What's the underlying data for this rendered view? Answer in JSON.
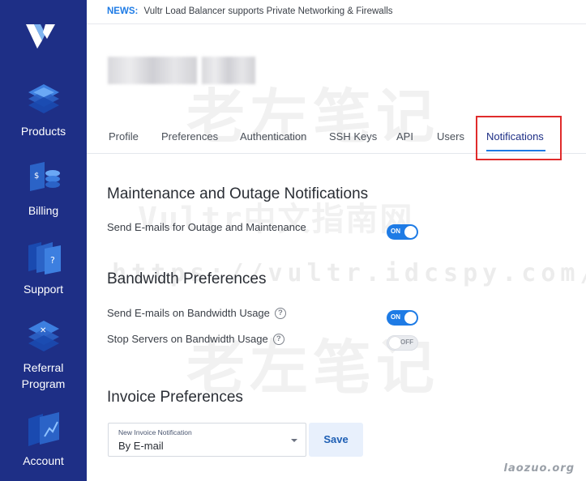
{
  "news": {
    "label": "NEWS:",
    "text": "Vultr Load Balancer supports Private Networking & Firewalls"
  },
  "sidebar": {
    "items": [
      {
        "label": "Products",
        "icon": "products-icon"
      },
      {
        "label": "Billing",
        "icon": "billing-icon"
      },
      {
        "label": "Support",
        "icon": "support-icon"
      },
      {
        "label": "Referral Program",
        "icon": "referral-icon"
      },
      {
        "label": "Account",
        "icon": "account-icon"
      }
    ]
  },
  "tabs": [
    {
      "label": "Profile"
    },
    {
      "label": "Preferences"
    },
    {
      "label": "Authentication"
    },
    {
      "label": "SSH Keys"
    },
    {
      "label": "API"
    },
    {
      "label": "Users"
    },
    {
      "label": "Notifications",
      "active": true
    }
  ],
  "sections": {
    "maintenance": {
      "title": "Maintenance and Outage Notifications",
      "rows": [
        {
          "label": "Send E-mails for Outage and Maintenance",
          "toggle": "ON"
        }
      ]
    },
    "bandwidth": {
      "title": "Bandwidth Preferences",
      "rows": [
        {
          "label": "Send E-mails on Bandwidth Usage",
          "toggle": "ON"
        },
        {
          "label": "Stop Servers on Bandwidth Usage",
          "toggle": "OFF"
        }
      ]
    },
    "invoice": {
      "title": "Invoice Preferences",
      "select_label": "New Invoice Notification",
      "select_value": "By E-mail",
      "save_label": "Save"
    }
  },
  "watermarks": {
    "line1": "老左笔记",
    "line2": "Vultr中文指南网",
    "line3": "https://vultr.idcspy.com/",
    "line4": "老左笔记",
    "corner": "laozuo.org"
  },
  "colors": {
    "sidebar": "#1e2f86",
    "accent": "#1e7be5",
    "highlight": "#e02b2b"
  }
}
